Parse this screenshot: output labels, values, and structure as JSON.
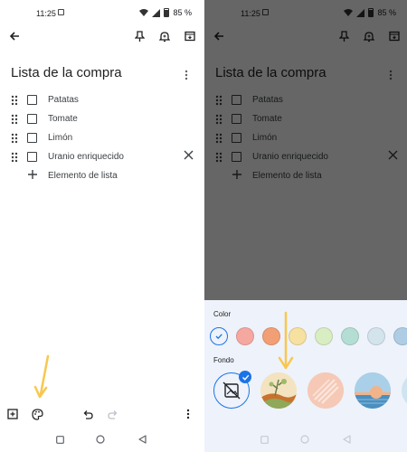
{
  "status": {
    "time": "11:25",
    "battery": "85 %"
  },
  "note": {
    "title": "Lista de la compra",
    "items": [
      {
        "label": "Patatas"
      },
      {
        "label": "Tomate"
      },
      {
        "label": "Limón"
      },
      {
        "label": "Uranio enriquecido"
      }
    ],
    "add_item_label": "Elemento de lista"
  },
  "sheet": {
    "color_label": "Color",
    "background_label": "Fondo",
    "colors": [
      "#ffffff",
      "#f4a8a0",
      "#f39f76",
      "#f6e1a0",
      "#d9edc2",
      "#b4ddd3",
      "#d4e4ed",
      "#aecce4"
    ],
    "selected_color_index": 0
  },
  "colors": {
    "accent": "#1a73e8",
    "arrow": "#f9c74f",
    "text": "#202124"
  }
}
